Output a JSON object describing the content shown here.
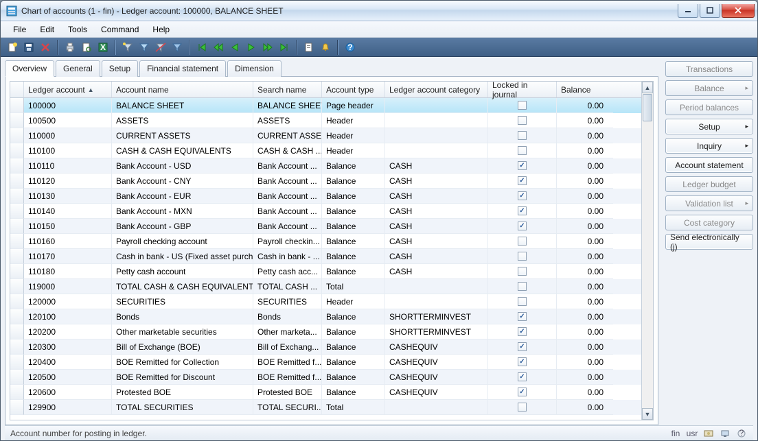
{
  "window": {
    "title": "Chart of accounts (1 - fin) - Ledger account: 100000, BALANCE SHEET"
  },
  "menubar": [
    "File",
    "Edit",
    "Tools",
    "Command",
    "Help"
  ],
  "tabs": [
    "Overview",
    "General",
    "Setup",
    "Financial statement",
    "Dimension"
  ],
  "grid": {
    "columns": [
      "Ledger account",
      "Account name",
      "Search name",
      "Account type",
      "Ledger account category",
      "Locked in journal",
      "Balance"
    ],
    "rows": [
      {
        "selected": true,
        "account": "100000",
        "name": "BALANCE SHEET",
        "search": "BALANCE SHEET",
        "type": "Page header",
        "category": "",
        "locked": false,
        "balance": "0.00"
      },
      {
        "account": "100500",
        "name": "ASSETS",
        "search": "ASSETS",
        "type": "Header",
        "category": "",
        "locked": false,
        "balance": "0.00"
      },
      {
        "account": "110000",
        "name": "CURRENT ASSETS",
        "search": "CURRENT ASSE...",
        "type": "Header",
        "category": "",
        "locked": false,
        "balance": "0.00"
      },
      {
        "account": "110100",
        "name": "CASH & CASH EQUIVALENTS",
        "search": "CASH & CASH ...",
        "type": "Header",
        "category": "",
        "locked": false,
        "balance": "0.00"
      },
      {
        "account": "110110",
        "name": "Bank Account - USD",
        "search": "Bank Account ...",
        "type": "Balance",
        "category": "CASH",
        "locked": true,
        "balance": "0.00"
      },
      {
        "account": "110120",
        "name": "Bank Account - CNY",
        "search": "Bank Account ...",
        "type": "Balance",
        "category": "CASH",
        "locked": true,
        "balance": "0.00"
      },
      {
        "account": "110130",
        "name": "Bank Account - EUR",
        "search": "Bank Account ...",
        "type": "Balance",
        "category": "CASH",
        "locked": true,
        "balance": "0.00"
      },
      {
        "account": "110140",
        "name": "Bank Account - MXN",
        "search": "Bank Account ...",
        "type": "Balance",
        "category": "CASH",
        "locked": true,
        "balance": "0.00"
      },
      {
        "account": "110150",
        "name": "Bank Account - GBP",
        "search": "Bank Account ...",
        "type": "Balance",
        "category": "CASH",
        "locked": true,
        "balance": "0.00"
      },
      {
        "account": "110160",
        "name": "Payroll checking account",
        "search": "Payroll checkin...",
        "type": "Balance",
        "category": "CASH",
        "locked": false,
        "balance": "0.00"
      },
      {
        "account": "110170",
        "name": "Cash in bank - US (Fixed asset purch)",
        "search": "Cash in bank - ...",
        "type": "Balance",
        "category": "CASH",
        "locked": false,
        "balance": "0.00"
      },
      {
        "account": "110180",
        "name": "Petty cash account",
        "search": "Petty cash acc...",
        "type": "Balance",
        "category": "CASH",
        "locked": false,
        "balance": "0.00"
      },
      {
        "account": "119000",
        "name": "TOTAL CASH & CASH EQUIVALENTS",
        "search": "TOTAL CASH ...",
        "type": "Total",
        "category": "",
        "locked": false,
        "balance": "0.00"
      },
      {
        "account": "120000",
        "name": "SECURITIES",
        "search": "SECURITIES",
        "type": "Header",
        "category": "",
        "locked": false,
        "balance": "0.00"
      },
      {
        "account": "120100",
        "name": "Bonds",
        "search": "Bonds",
        "type": "Balance",
        "category": "SHORTTERMINVEST",
        "locked": true,
        "balance": "0.00"
      },
      {
        "account": "120200",
        "name": "Other marketable securities",
        "search": "Other marketa...",
        "type": "Balance",
        "category": "SHORTTERMINVEST",
        "locked": true,
        "balance": "0.00"
      },
      {
        "account": "120300",
        "name": "Bill of Exchange (BOE)",
        "search": "Bill of Exchang...",
        "type": "Balance",
        "category": "CASHEQUIV",
        "locked": true,
        "balance": "0.00"
      },
      {
        "account": "120400",
        "name": "BOE Remitted for Collection",
        "search": "BOE Remitted f...",
        "type": "Balance",
        "category": "CASHEQUIV",
        "locked": true,
        "balance": "0.00"
      },
      {
        "account": "120500",
        "name": "BOE Remitted for Discount",
        "search": "BOE Remitted f...",
        "type": "Balance",
        "category": "CASHEQUIV",
        "locked": true,
        "balance": "0.00"
      },
      {
        "account": "120600",
        "name": "Protested BOE",
        "search": "Protested BOE",
        "type": "Balance",
        "category": "CASHEQUIV",
        "locked": true,
        "balance": "0.00"
      },
      {
        "account": "129900",
        "name": "TOTAL SECURITIES",
        "search": "TOTAL SECURI...",
        "type": "Total",
        "category": "",
        "locked": false,
        "balance": "0.00"
      }
    ]
  },
  "sidebar": [
    {
      "label": "Transactions",
      "enabled": false
    },
    {
      "label": "Balance",
      "enabled": false,
      "menu": true
    },
    {
      "label": "Period balances",
      "enabled": false
    },
    {
      "label": "Setup",
      "enabled": true,
      "menu": true
    },
    {
      "label": "Inquiry",
      "enabled": true,
      "menu": true
    },
    {
      "label": "Account statement",
      "enabled": true
    },
    {
      "label": "Ledger budget",
      "enabled": false
    },
    {
      "label": "Validation list",
      "enabled": false,
      "menu": true
    },
    {
      "label": "Cost category",
      "enabled": false
    },
    {
      "label": "Send electronically",
      "shortcut": "j",
      "enabled": true
    }
  ],
  "statusbar": {
    "text": "Account number for posting in ledger.",
    "company": "fin",
    "user": "usr"
  }
}
